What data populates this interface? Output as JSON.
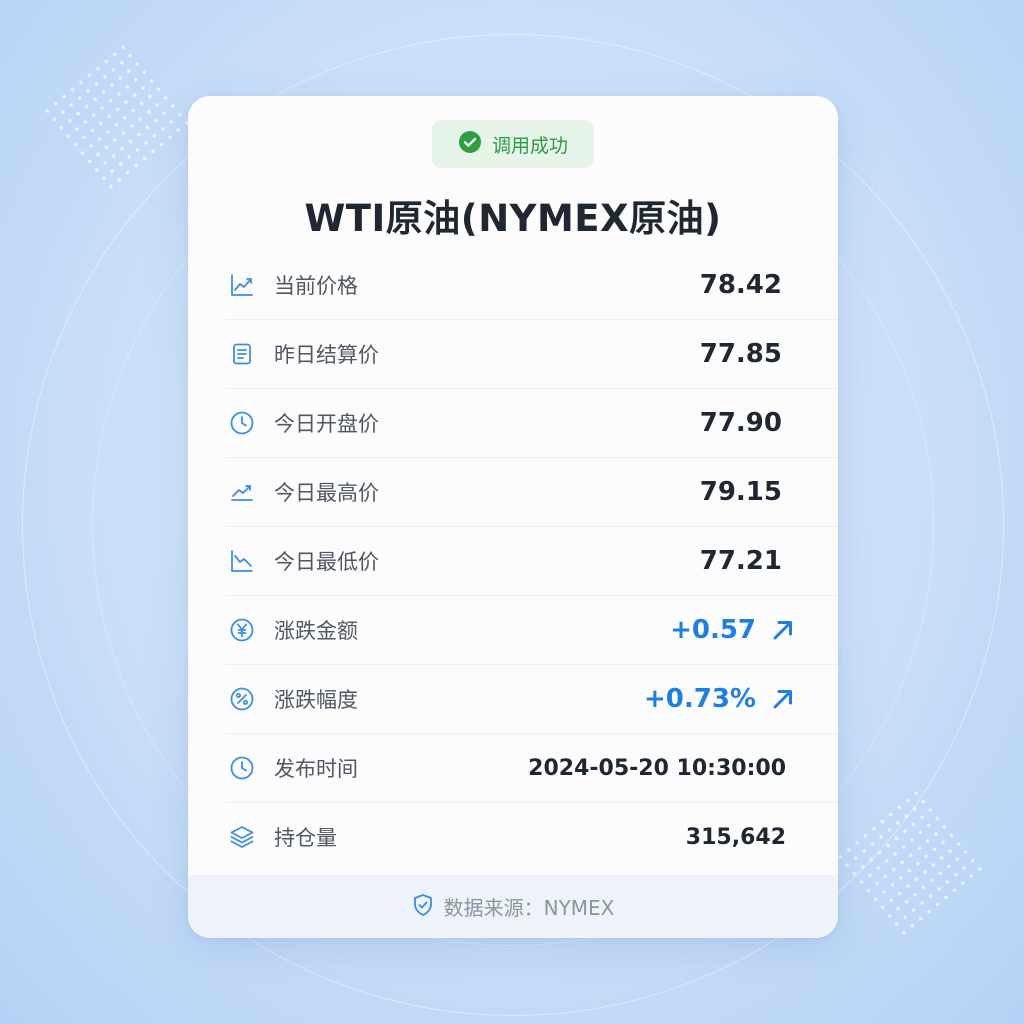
{
  "status": {
    "label": "调用成功",
    "color": "#2f9a43"
  },
  "title": "WTI原油(NYMEX原油)",
  "rows": [
    {
      "icon": "line-chart-icon",
      "label": "当前价格",
      "value": "78.42"
    },
    {
      "icon": "document-icon",
      "label": "昨日结算价",
      "value": "77.85"
    },
    {
      "icon": "clock-icon",
      "label": "今日开盘价",
      "value": "77.90"
    },
    {
      "icon": "trend-up-icon",
      "label": "今日最高价",
      "value": "79.15"
    },
    {
      "icon": "trend-down-icon",
      "label": "今日最低价",
      "value": "77.21"
    },
    {
      "icon": "yuan-icon",
      "label": "涨跌金额",
      "value": "+0.57",
      "direction": "up"
    },
    {
      "icon": "percent-icon",
      "label": "涨跌幅度",
      "value": "+0.73%",
      "direction": "up"
    },
    {
      "icon": "clock-icon",
      "label": "发布时间",
      "value": "2024-05-20 10:30:00"
    },
    {
      "icon": "layers-icon",
      "label": "持仓量",
      "value": "315,642"
    }
  ],
  "footer": {
    "label": "数据来源：",
    "value": "NYMEX"
  },
  "colors": {
    "accent": "#1f7fe0",
    "success": "#2f9a43",
    "text": "#1f2733",
    "label": "#505863"
  }
}
